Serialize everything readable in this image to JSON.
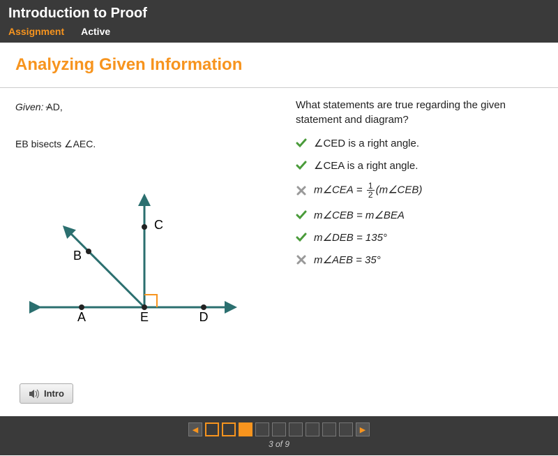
{
  "header": {
    "title": "Introduction to Proof",
    "tab_assignment": "Assignment",
    "tab_active": "Active"
  },
  "section_title": "Analyzing Given Information",
  "given_label": "Given:",
  "given_line1_segment": "AD",
  "given_line2_pre": "EB",
  "given_line2_post": " bisects ∠AEC.",
  "diagram": {
    "labels": {
      "A": "A",
      "B": "B",
      "C": "C",
      "D": "D",
      "E": "E"
    }
  },
  "question": "What statements are true regarding the given statement and diagram?",
  "answers": [
    {
      "correct": true,
      "text": "∠CED is a right angle."
    },
    {
      "correct": true,
      "text": "∠CEA is a right angle."
    },
    {
      "correct": false,
      "html": "mCEA_eq_half_mCEB"
    },
    {
      "correct": true,
      "html": "mCEB_eq_mBEA"
    },
    {
      "correct": true,
      "html": "mDEB_eq_135"
    },
    {
      "correct": false,
      "html": "mAEB_eq_35"
    }
  ],
  "answer_fragments": {
    "mCEA_eq_half_mCEB": {
      "lhs": "m∠CEA",
      "op": " = ",
      "frac_num": "1",
      "frac_den": "2",
      "rhs": "(m∠CEB)"
    },
    "mCEB_eq_mBEA": "m∠CEB = m∠BEA",
    "mDEB_eq_135": "m∠DEB = 135°",
    "mAEB_eq_35": "m∠AEB = 35°"
  },
  "intro_button": "Intro",
  "footer": {
    "current": 3,
    "total": 9,
    "text": "3 of 9"
  }
}
